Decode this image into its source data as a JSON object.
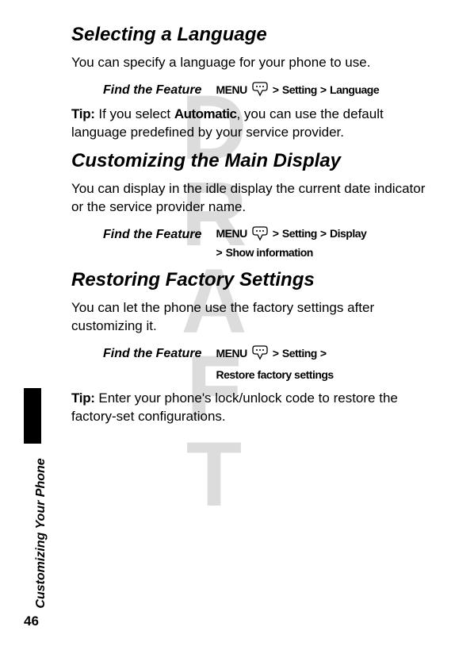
{
  "watermark": "DRAFT",
  "page_number": "46",
  "side_label": "Customizing Your Phone",
  "sections": {
    "s1": {
      "title": "Selecting a Language",
      "body": "You can specify a language for your phone to use.",
      "feature_label": "Find the Feature",
      "menu_label": "MENU",
      "sep": ">",
      "path1": "Setting",
      "path2": "Language",
      "tip_label": "Tip:",
      "tip_pre": "If you select",
      "tip_emph": "Automatic",
      "tip_post": ", you can use the default language predefined by your service provider."
    },
    "s2": {
      "title": "Customizing the Main Display",
      "body": "You can display in the idle display the current date indicator or the service provider name.",
      "feature_label": "Find the Feature",
      "menu_label": "MENU",
      "sep": ">",
      "path1": "Setting",
      "path2": "Display",
      "line2_sep": ">",
      "line2_path": "Show information"
    },
    "s3": {
      "title": "Restoring Factory Settings",
      "body": "You can let the phone use the factory settings after customizing it.",
      "feature_label": "Find the Feature",
      "menu_label": "MENU",
      "sep": ">",
      "path1": "Setting",
      "path2": "Restore factory settings",
      "tip_label": "Tip:",
      "tip_body": "Enter your phone's lock/unlock code to restore the factory-set configurations."
    }
  }
}
